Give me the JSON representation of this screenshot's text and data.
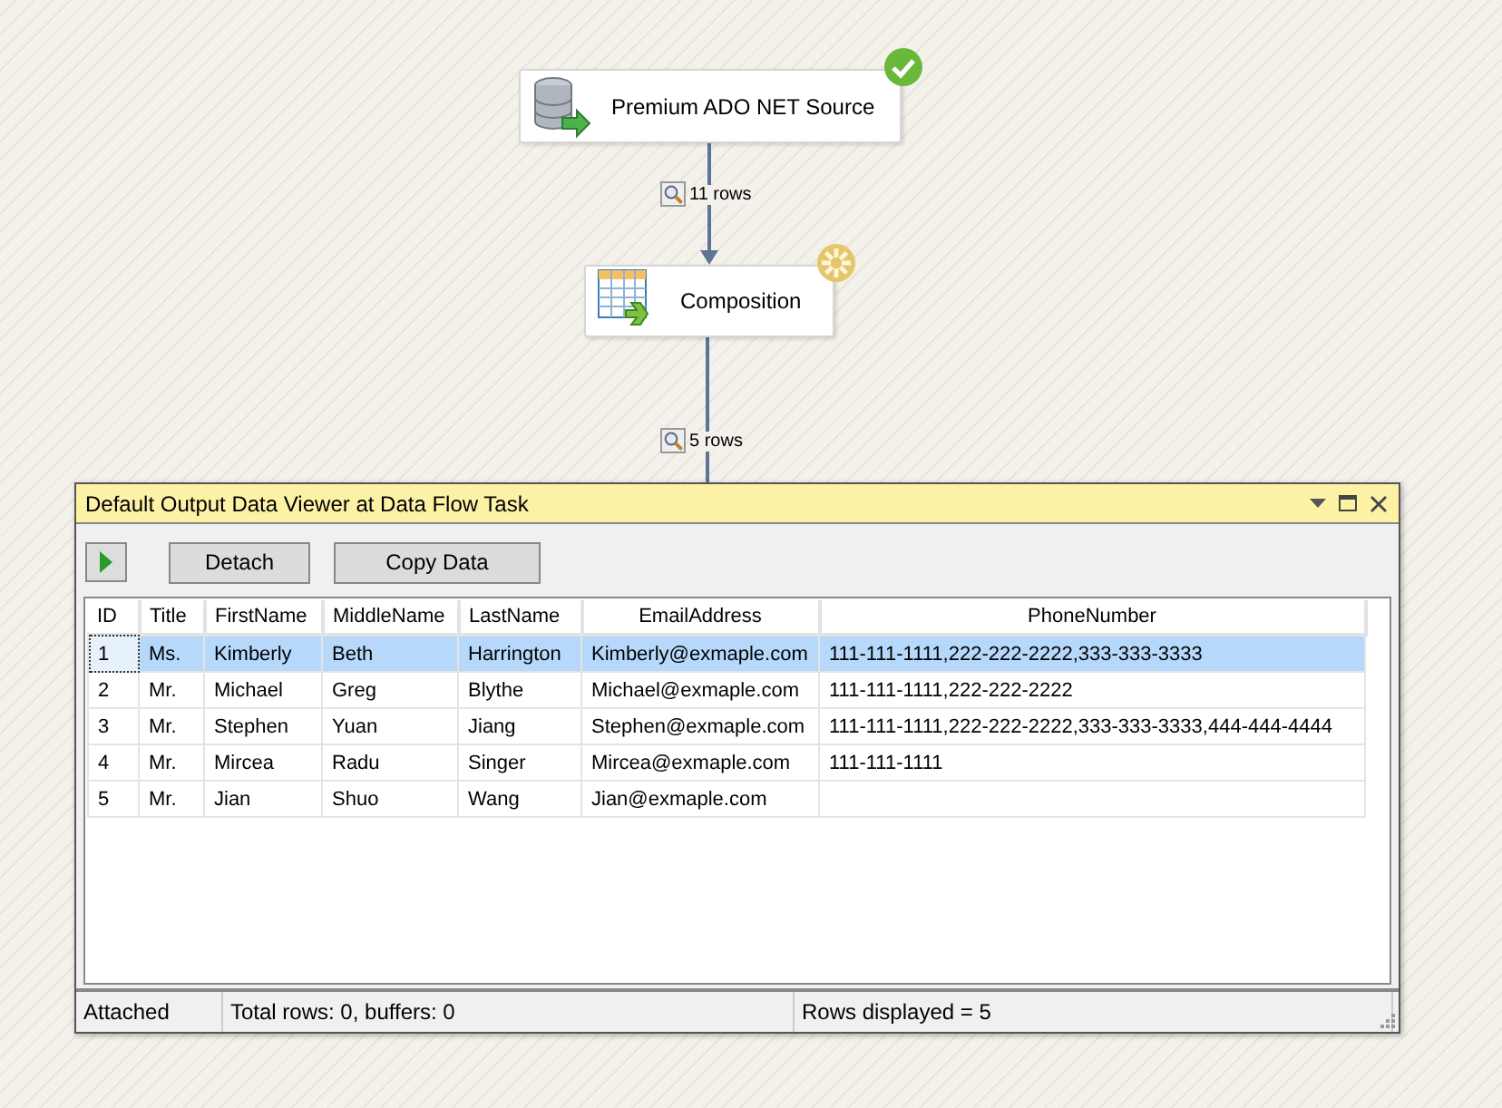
{
  "canvas": {
    "nodes": [
      {
        "label": "Premium ADO NET Source",
        "kind": "source",
        "completed": true
      },
      {
        "label": "Composition",
        "kind": "transform",
        "completed": false
      }
    ],
    "paths": [
      {
        "rows": "11 rows"
      },
      {
        "rows": "5 rows"
      }
    ]
  },
  "viewer": {
    "title": "Default Output Data Viewer at Data Flow Task",
    "toolbar": {
      "buttons": [
        "Detach",
        "Copy Data"
      ]
    },
    "table": {
      "columns": [
        "ID",
        "Title",
        "FirstName",
        "MiddleName",
        "LastName",
        "EmailAddress",
        "PhoneNumber"
      ],
      "rows": [
        {
          "selected": true,
          "cells": [
            "1",
            "Ms.",
            "Kimberly",
            "Beth",
            "Harrington",
            "Kimberly@exmaple.com",
            "111-111-1111,222-222-2222,333-333-3333"
          ]
        },
        {
          "selected": false,
          "cells": [
            "2",
            "Mr.",
            "Michael",
            "Greg",
            "Blythe",
            "Michael@exmaple.com",
            "111-111-1111,222-222-2222"
          ]
        },
        {
          "selected": false,
          "cells": [
            "3",
            "Mr.",
            "Stephen",
            "Yuan",
            "Jiang",
            "Stephen@exmaple.com",
            "111-111-1111,222-222-2222,333-333-3333,444-444-4444"
          ]
        },
        {
          "selected": false,
          "cells": [
            "4",
            "Mr.",
            "Mircea",
            "Radu",
            "Singer",
            "Mircea@exmaple.com",
            "111-111-1111"
          ]
        },
        {
          "selected": false,
          "cells": [
            "5",
            "Mr.",
            "Jian",
            "Shuo",
            "Wang",
            "Jian@exmaple.com",
            ""
          ]
        }
      ]
    },
    "status_bar": [
      "Attached",
      "Total rows: 0, buffers: 0",
      "Rows displayed = 5"
    ]
  }
}
